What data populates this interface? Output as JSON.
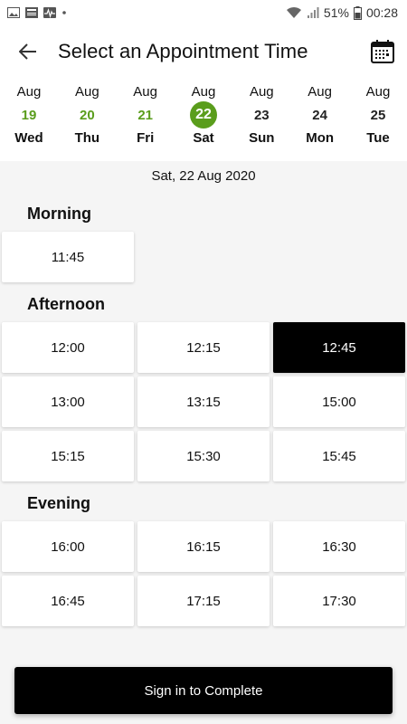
{
  "status_bar": {
    "battery": "51%",
    "time": "00:28"
  },
  "header": {
    "title": "Select an Appointment Time"
  },
  "dates": [
    {
      "month": "Aug",
      "day": "19",
      "weekday": "Wed",
      "state": "past"
    },
    {
      "month": "Aug",
      "day": "20",
      "weekday": "Thu",
      "state": "past"
    },
    {
      "month": "Aug",
      "day": "21",
      "weekday": "Fri",
      "state": "past"
    },
    {
      "month": "Aug",
      "day": "22",
      "weekday": "Sat",
      "state": "selected"
    },
    {
      "month": "Aug",
      "day": "23",
      "weekday": "Sun",
      "state": "future"
    },
    {
      "month": "Aug",
      "day": "24",
      "weekday": "Mon",
      "state": "future"
    },
    {
      "month": "Aug",
      "day": "25",
      "weekday": "Tue",
      "state": "future"
    }
  ],
  "selected_date": "Sat, 22 Aug 2020",
  "sections": [
    {
      "title": "Morning",
      "slots": [
        "11:45"
      ]
    },
    {
      "title": "Afternoon",
      "slots": [
        "12:00",
        "12:15",
        "12:45",
        "13:00",
        "13:15",
        "15:00",
        "15:15",
        "15:30",
        "15:45"
      ]
    },
    {
      "title": "Evening",
      "slots": [
        "16:00",
        "16:15",
        "16:30",
        "16:45",
        "17:15",
        "17:30"
      ]
    }
  ],
  "selected_slot": "12:45",
  "cta_label": "Sign in to Complete",
  "colors": {
    "accent": "#5a9d1c",
    "selected_slot_bg": "#000000"
  }
}
